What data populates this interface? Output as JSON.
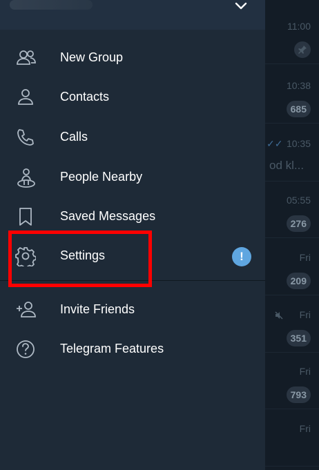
{
  "menu": {
    "new_group": "New Group",
    "contacts": "Contacts",
    "calls": "Calls",
    "people_nearby": "People Nearby",
    "saved_messages": "Saved Messages",
    "settings": "Settings",
    "settings_badge": "!",
    "invite_friends": "Invite Friends",
    "telegram_features": "Telegram Features"
  },
  "chat_list": [
    {
      "time": "11:00",
      "badge": ""
    },
    {
      "time": "10:38",
      "badge": "685"
    },
    {
      "time": "10:35",
      "badge": "",
      "preview": "od kl..."
    },
    {
      "time": "05:55",
      "badge": "276"
    },
    {
      "time": "Fri",
      "badge": "209"
    },
    {
      "time": "Fri",
      "badge": "351"
    },
    {
      "time": "Fri",
      "badge": "793"
    },
    {
      "time": "Fri",
      "badge": ""
    }
  ],
  "colors": {
    "drawer_bg": "#1e2a37",
    "accent": "#5fa6e0",
    "highlight": "#ff0000"
  }
}
